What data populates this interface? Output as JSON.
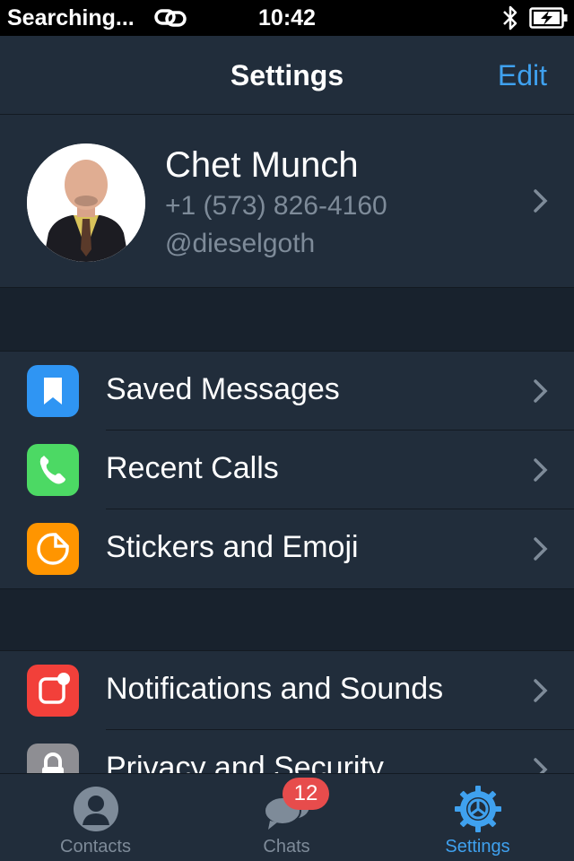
{
  "status_bar": {
    "carrier": "Searching...",
    "time": "10:42"
  },
  "nav": {
    "title": "Settings",
    "edit_label": "Edit"
  },
  "profile": {
    "name": "Chet Munch",
    "phone": "+1 (573) 826-4160",
    "username": "@dieselgoth"
  },
  "menu_group_1": [
    {
      "label": "Saved Messages",
      "icon": "bookmark-icon",
      "color": "#2f95f3"
    },
    {
      "label": "Recent Calls",
      "icon": "phone-icon",
      "color": "#4cd964"
    },
    {
      "label": "Stickers and Emoji",
      "icon": "sticker-icon",
      "color": "#ff9500"
    }
  ],
  "menu_group_2": [
    {
      "label": "Notifications and Sounds",
      "icon": "notification-icon",
      "color": "#f2403a"
    },
    {
      "label": "Privacy and Security",
      "icon": "lock-icon",
      "color": "#8e8e93"
    }
  ],
  "tabs": [
    {
      "label": "Contacts",
      "icon": "person-icon"
    },
    {
      "label": "Chats",
      "icon": "chat-bubbles-icon",
      "badge": "12"
    },
    {
      "label": "Settings",
      "icon": "gear-icon",
      "active": true
    }
  ],
  "colors": {
    "accent": "#3fa1ef",
    "background": "#18222d",
    "cell": "#212d3b",
    "secondary_text": "#7e8b99",
    "badge": "#e74c4c"
  }
}
